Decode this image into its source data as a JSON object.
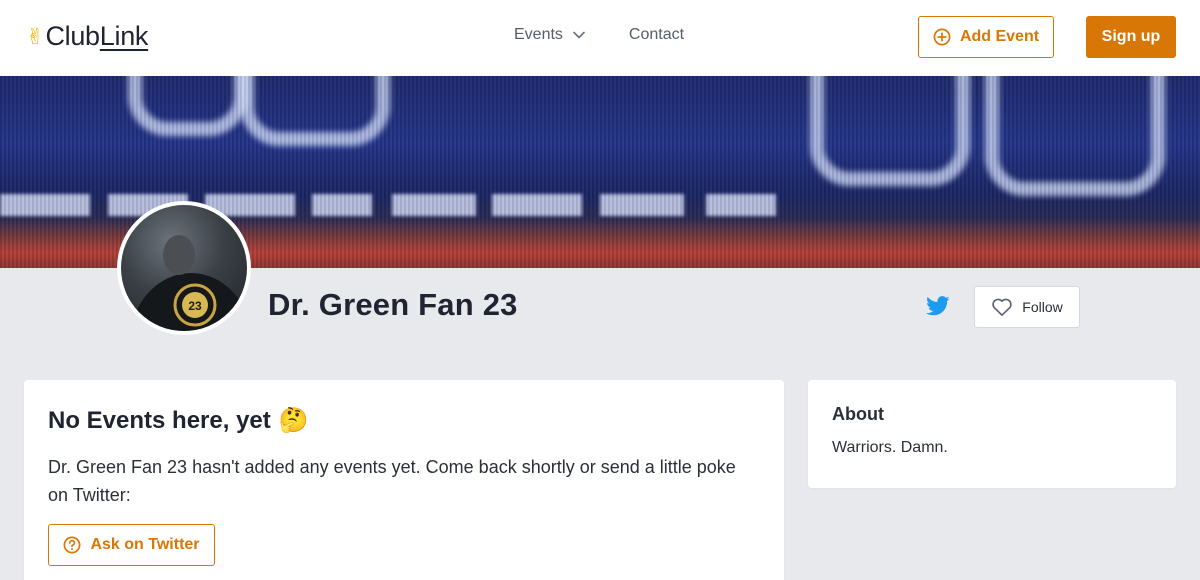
{
  "header": {
    "logo": {
      "hand": "✌",
      "club": "Club",
      "link": "Link"
    },
    "nav": {
      "events_label": "Events",
      "contact_label": "Contact"
    },
    "add_event_label": "Add Event",
    "signup_label": "Sign up",
    "accent_color": "#d97706"
  },
  "profile": {
    "name": "Dr. Green Fan 23",
    "follow_label": "Follow",
    "twitter_color": "#1d9bf0"
  },
  "events_card": {
    "title": "No Events here, yet",
    "title_emoji": "🤔",
    "message": "Dr. Green Fan 23 hasn't added any events yet. Come back shortly or send a little poke on Twitter:",
    "ask_label": "Ask on Twitter"
  },
  "about_card": {
    "title": "About",
    "text": "Warriors. Damn."
  },
  "icons": {
    "events_dropdown": "chevron-down-icon",
    "add_event": "plus-circle-icon",
    "twitter": "twitter-icon",
    "follow": "heart-icon",
    "ask": "question-circle-icon"
  }
}
